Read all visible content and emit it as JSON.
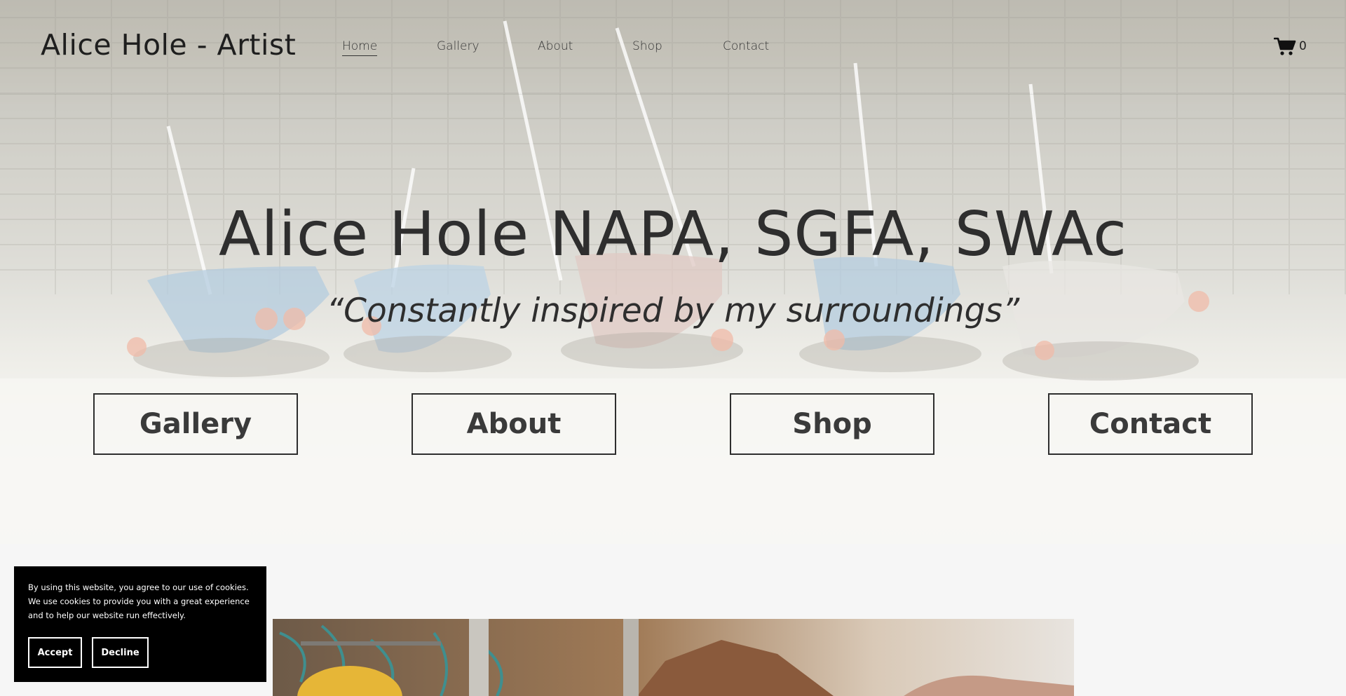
{
  "header": {
    "site_title": "Alice Hole - Artist",
    "nav": [
      {
        "label": "Home",
        "active": true
      },
      {
        "label": "Gallery",
        "active": false
      },
      {
        "label": "About",
        "active": false
      },
      {
        "label": "Shop",
        "active": false
      },
      {
        "label": "Contact",
        "active": false
      }
    ],
    "cart": {
      "icon": "cart-icon",
      "count": "0"
    }
  },
  "hero": {
    "heading": "Alice Hole NAPA, SGFA, SWAc",
    "tagline": "“Constantly inspired by my surroundings”",
    "buttons": [
      {
        "label": "Gallery"
      },
      {
        "label": "About"
      },
      {
        "label": "Shop"
      },
      {
        "label": "Contact"
      }
    ]
  },
  "cookie_banner": {
    "text": "By using this website, you agree to our use of cookies. We use cookies to provide you with a great experience and to help our website run effectively.",
    "accept_label": "Accept",
    "decline_label": "Decline"
  },
  "colors": {
    "text": "#2e2e2e",
    "page_background": "#f6f6f6",
    "cookie_background": "#000000"
  }
}
